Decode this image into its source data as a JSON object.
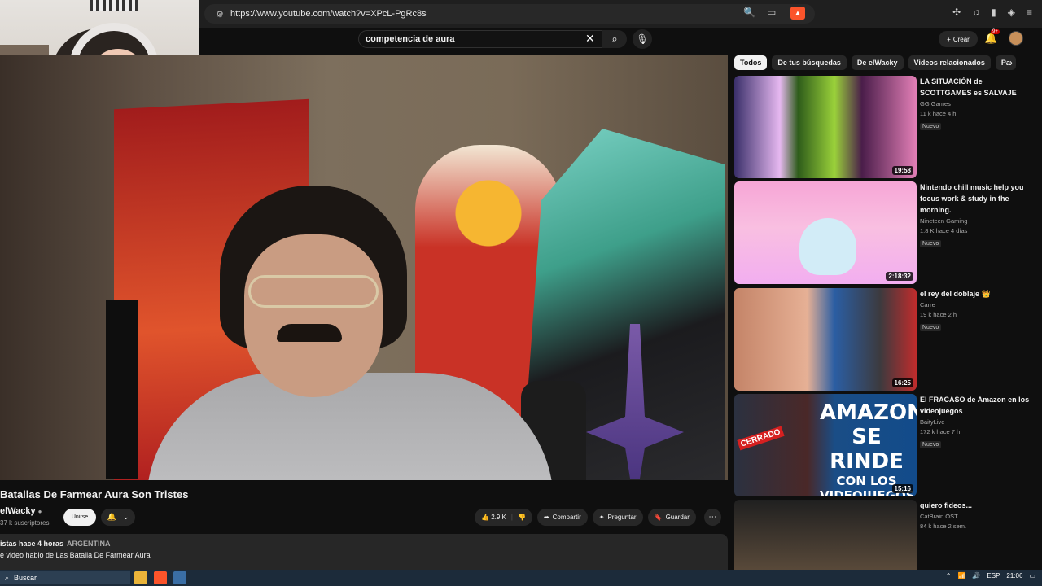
{
  "browser": {
    "url": "https://www.youtube.com/watch?v=XPcL-PgRc8s"
  },
  "header": {
    "search_value": "competencia de aura",
    "create_label": "Crear",
    "notif_count": "9+"
  },
  "video": {
    "title": "Batallas De Farmear Aura Son Tristes",
    "channel": "elWacky",
    "subscribers": "37 k suscriptores",
    "join_label": "Unirse",
    "likes": "2.9 K",
    "share_label": "Compartir",
    "ask_label": "Preguntar",
    "save_label": "Guardar",
    "desc_meta": "istas  hace 4 horas",
    "desc_country": "ARGENTINA",
    "desc_text": "e video hablo de Las Batalla De Farmear Aura"
  },
  "chips": [
    "Todos",
    "De tus búsquedas",
    "De elWacky",
    "Videos relacionados",
    "Pa"
  ],
  "sidebar": [
    {
      "title": "LA SITUACIÓN de SCOTTGAMES es SALVAJE",
      "channel": "GG Games",
      "meta": "11 k  hace 4 h",
      "badge": "Nuevo",
      "duration": "19:58"
    },
    {
      "title": "Nintendo chill music help you focus work & study in the morning.",
      "channel": "Nineteen Gaming",
      "meta": "1.8 K  hace 4 días",
      "badge": "Nuevo",
      "duration": "2:18:32"
    },
    {
      "title": "el rey del doblaje 👑",
      "channel": "Carre",
      "meta": "19 k  hace 2 h",
      "badge": "Nuevo",
      "duration": "16:25"
    },
    {
      "title": "El FRACASO de Amazon en los videojuegos",
      "channel": "BaityLive",
      "meta": "172 k  hace 7 h",
      "badge": "Nuevo",
      "duration": "15:16",
      "thumb_text_big": "AMAZON SE RINDE",
      "thumb_text_small": "CON LOS VIDEOJUEGOS",
      "thumb_tag": "CERRADO"
    },
    {
      "title": "quiero fideos...",
      "channel": "CatBrain OST",
      "meta": "84 k  hace 2 sem.",
      "badge": "",
      "duration": ""
    }
  ],
  "taskbar": {
    "search_label": "Buscar",
    "lang": "ESP",
    "time": "21:06"
  }
}
